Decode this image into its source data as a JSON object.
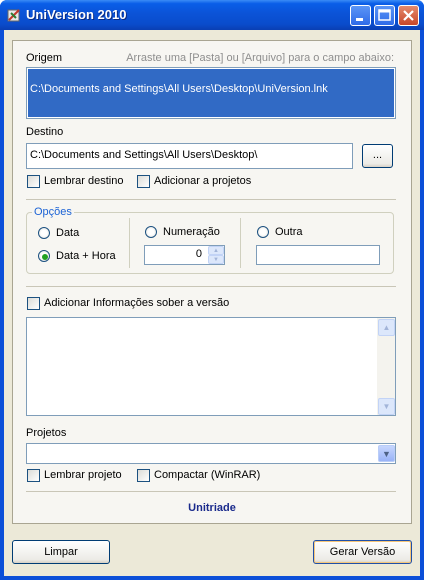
{
  "window": {
    "title": "UniVersion 2010",
    "controls": [
      "minimize-icon",
      "maximize-icon",
      "close-icon"
    ]
  },
  "origem": {
    "label": "Origem",
    "hint": "Arraste uma [Pasta] ou [Arquivo] para o campo abaixo:",
    "value": "C:\\Documents and Settings\\All Users\\Desktop\\UniVersion.lnk"
  },
  "destino": {
    "label": "Destino",
    "value": "C:\\Documents and Settings\\All Users\\Desktop\\",
    "browse_label": "...",
    "lembrar_label": "Lembrar destino",
    "adicionar_label": "Adicionar a projetos"
  },
  "opcoes": {
    "title": "Opções",
    "data_label": "Data",
    "data_hora_label": "Data + Hora",
    "numeracao_label": "Numeração",
    "numeracao_value": "0",
    "outra_label": "Outra",
    "outra_value": "",
    "selected": "Data + Hora"
  },
  "info": {
    "checkbox_label": "Adicionar Informações sober a versão",
    "text": ""
  },
  "projetos": {
    "label": "Projetos",
    "selected": "",
    "lembrar_label": "Lembrar projeto",
    "compactar_label": "Compactar (WinRAR)"
  },
  "brand": "Unitriade",
  "buttons": {
    "limpar": "Limpar",
    "gerar": "Gerar Versão"
  },
  "colors": {
    "titlebar": "#0b53d7",
    "selection": "#316ac5",
    "group_title": "#1c63d5",
    "brand": "#1a2a8c",
    "radio_dot": "#21a121"
  }
}
